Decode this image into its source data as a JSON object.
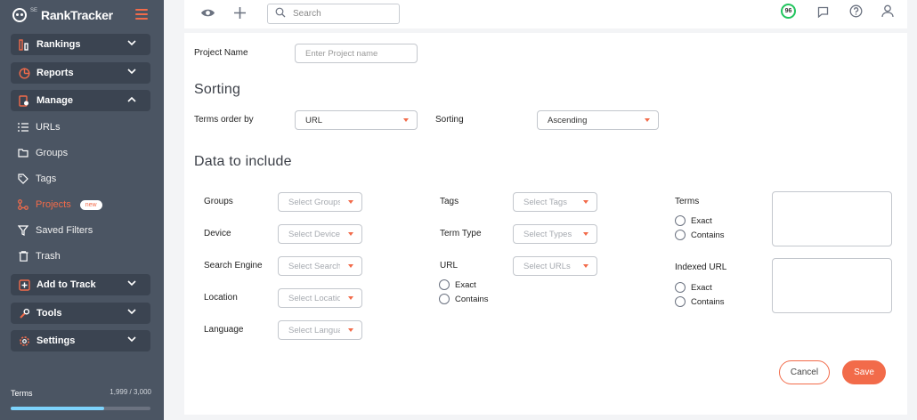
{
  "brand": {
    "fine": "SE",
    "name": "RankTracker"
  },
  "sidebar": {
    "groups": [
      {
        "label": "Rankings",
        "icon": "bar-chart-icon"
      },
      {
        "label": "Reports",
        "icon": "pie-chart-icon"
      },
      {
        "label": "Manage",
        "icon": "manage-file-icon"
      },
      {
        "label": "Add to Track",
        "icon": "plus-square-icon"
      },
      {
        "label": "Tools",
        "icon": "tools-icon"
      },
      {
        "label": "Settings",
        "icon": "gear-icon"
      }
    ],
    "manage_items": [
      {
        "label": "URLs",
        "icon": "list-icon"
      },
      {
        "label": "Groups",
        "icon": "folder-icon"
      },
      {
        "label": "Tags",
        "icon": "tag-icon"
      },
      {
        "label": "Projects",
        "icon": "projects-icon",
        "badge": "new"
      },
      {
        "label": "Saved Filters",
        "icon": "filter-icon"
      },
      {
        "label": "Trash",
        "icon": "trash-icon"
      }
    ],
    "terms": {
      "label": "Terms",
      "count": "1,999 / 3,000",
      "fraction": 0.6663
    }
  },
  "topbar": {
    "search_placeholder": "Search",
    "score": "96"
  },
  "form": {
    "project_name_label": "Project Name",
    "project_name_placeholder": "Enter Project name",
    "sorting_heading": "Sorting",
    "terms_order_label": "Terms order by",
    "terms_order_value": "URL",
    "sorting_label": "Sorting",
    "sorting_value": "Ascending",
    "data_heading": "Data to include",
    "groups_label": "Groups",
    "groups_placeholder": "Select Groups",
    "device_label": "Device",
    "device_placeholder": "Select Devices",
    "search_engine_label": "Search Engine",
    "search_engine_placeholder": "Select Search Engines",
    "location_label": "Location",
    "location_placeholder": "Select Locations",
    "language_label": "Language",
    "language_placeholder": "Select Languages",
    "tags_label": "Tags",
    "tags_placeholder": "Select Tags",
    "term_type_label": "Term Type",
    "term_type_placeholder": "Select Types",
    "url_label": "URL",
    "url_placeholder": "Select URLs",
    "exact": "Exact",
    "contains": "Contains",
    "terms_label": "Terms",
    "indexed_url_label": "Indexed URL",
    "cancel": "Cancel",
    "save": "Save"
  },
  "colors": {
    "accent": "#f26b4a",
    "sidebar": "#4b5563",
    "score_ring": "#22c55e"
  }
}
